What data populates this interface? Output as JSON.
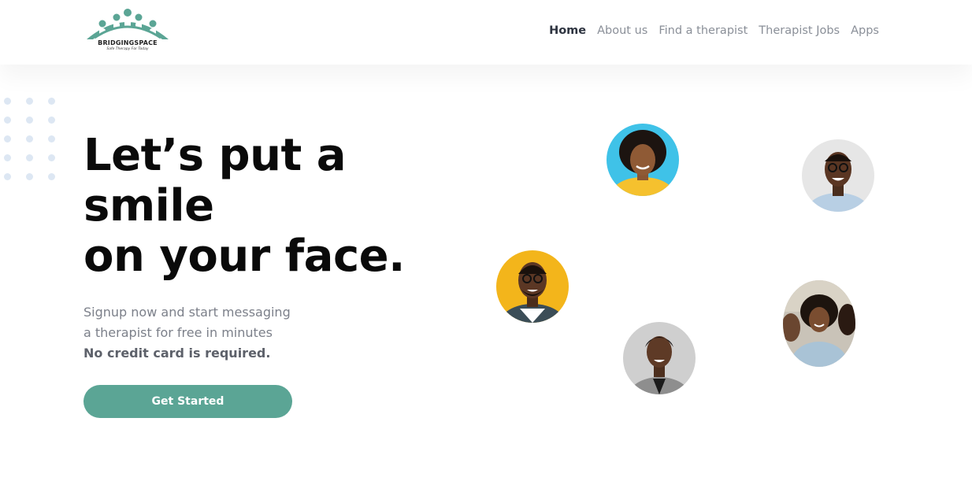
{
  "brand": {
    "name": "BRIDGINGSPACE",
    "tagline": "Safe Therapy For Today",
    "color": "#5ba595"
  },
  "nav": {
    "items": [
      {
        "label": "Home",
        "active": true
      },
      {
        "label": "About us",
        "active": false
      },
      {
        "label": "Find a therapist",
        "active": false
      },
      {
        "label": "Therapist Jobs",
        "active": false
      },
      {
        "label": "Apps",
        "active": false
      }
    ]
  },
  "hero": {
    "title_lines": [
      "Let’s put a",
      "smile",
      "on your face."
    ],
    "subtitle_lines": [
      "Signup now and start messaging",
      "a therapist for free in minutes"
    ],
    "emphasis": "No credit card is required.",
    "cta_label": "Get Started"
  },
  "avatars": [
    {
      "name": "woman-curly-hair-avatar",
      "bg": "#3fc2e8"
    },
    {
      "name": "man-glasses-light-avatar",
      "bg": "#e6e6e6"
    },
    {
      "name": "man-glasses-yellow-avatar",
      "bg": "#f3b51b"
    },
    {
      "name": "group-photo-avatar",
      "bg": "#c9c3b8"
    },
    {
      "name": "woman-short-hair-avatar",
      "bg": "#cfcfcf"
    }
  ],
  "colors": {
    "accent": "#5ba595",
    "heading": "#0a0a0a",
    "body_text": "#7c808a",
    "nav_text": "#8a8f98",
    "nav_active": "#2e3440",
    "dots": "#dde7f3"
  }
}
